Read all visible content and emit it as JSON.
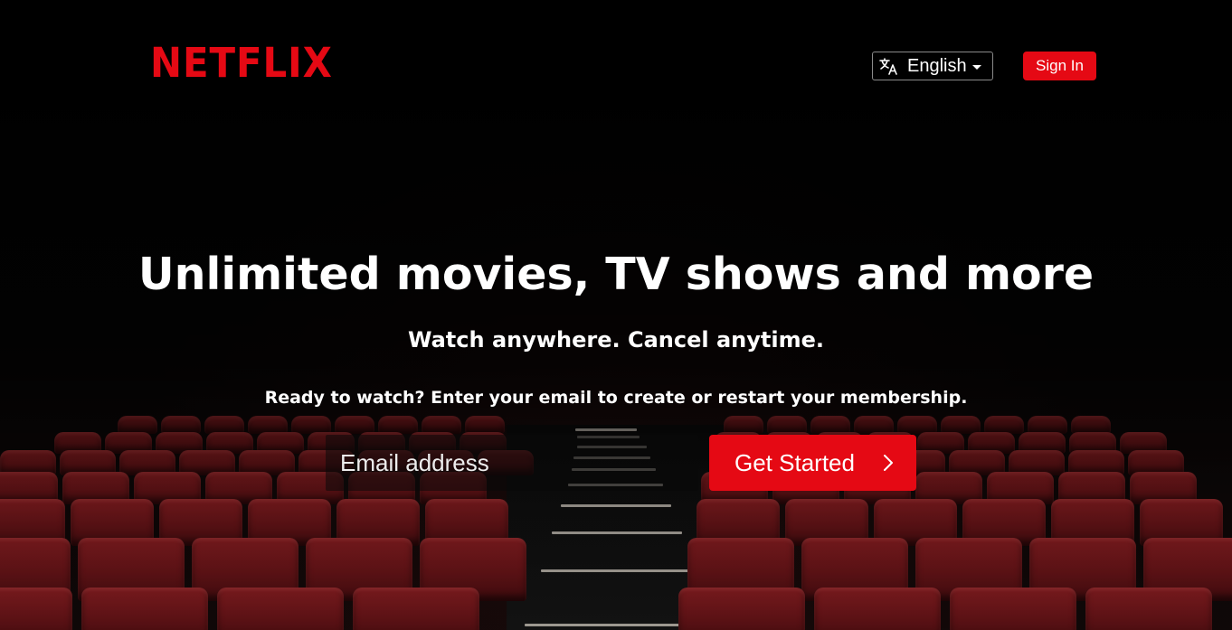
{
  "brand": {
    "logo_text": "NETFLIX",
    "color": "#e50914"
  },
  "header": {
    "language_selector": {
      "icon": "translate-icon",
      "selected": "English"
    },
    "sign_in_label": "Sign In"
  },
  "hero": {
    "headline": "Unlimited movies, TV shows and more",
    "subheadline": "Watch anywhere. Cancel anytime.",
    "prompt": "Ready to watch? Enter your email to create or restart your membership.",
    "email_placeholder": "Email address",
    "cta_label": "Get Started",
    "cta_icon": "chevron-right-icon"
  }
}
